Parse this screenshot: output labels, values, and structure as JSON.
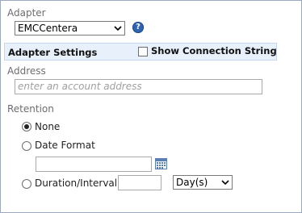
{
  "adapter": {
    "label": "Adapter",
    "selected": "EMCCentera",
    "help_icon": "help-icon",
    "help_glyph": "?"
  },
  "adapter_settings": {
    "title": "Adapter Settings",
    "show_connection_string": {
      "label": "Show Connection String",
      "checked": false
    }
  },
  "address": {
    "label": "Address",
    "placeholder": "enter an account address",
    "value": ""
  },
  "retention": {
    "label": "Retention",
    "options": [
      {
        "label": "None",
        "checked": true
      },
      {
        "label": "Date Format",
        "checked": false
      },
      {
        "label": "Duration/Interval",
        "checked": false
      }
    ],
    "date_value": "",
    "calendar_icon": "calendar-icon",
    "duration_value": "",
    "duration_unit": "Day(s)"
  },
  "colors": {
    "border": "#9aa9bd",
    "band_bg": "#e8f0fb",
    "help_bg": "#2e64b0",
    "label_gray": "#6e6e6e"
  }
}
